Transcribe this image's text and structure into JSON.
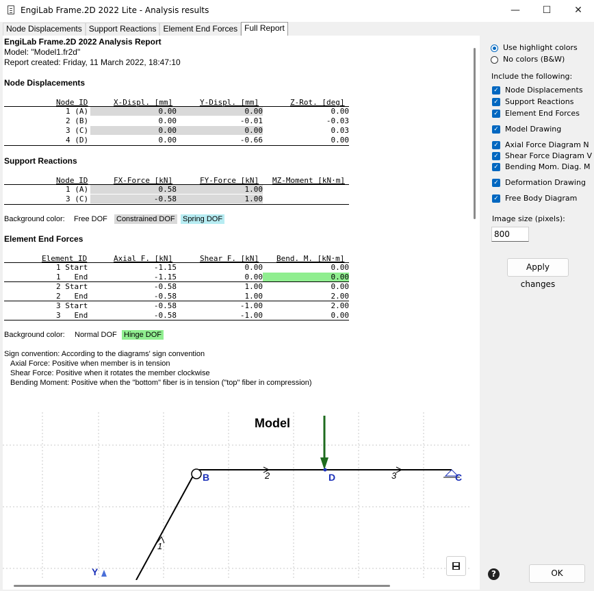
{
  "window": {
    "title": "EngiLab Frame.2D 2022 Lite - Analysis results",
    "minimize": "—",
    "maximize": "☐",
    "close": "✕"
  },
  "tabs": [
    {
      "label": "Node Displacements"
    },
    {
      "label": "Support Reactions"
    },
    {
      "label": "Element End Forces"
    },
    {
      "label": "Full Report",
      "active": true
    }
  ],
  "report": {
    "title": "EngiLab Frame.2D 2022 Analysis Report",
    "model": "Model: \"Model1.fr2d\"",
    "created": "Report created: Friday, 11 March 2022, 18:47:10",
    "node_displacements": {
      "heading": "Node Displacements",
      "columns": [
        "Node ID",
        "X-Displ. [mm]",
        "Y-Displ. [mm]",
        "Z-Rot. [deg]"
      ],
      "rows": [
        [
          "1 (A)",
          "0.00",
          "0.00",
          "0.00"
        ],
        [
          "2 (B)",
          "0.00",
          "-0.01",
          "-0.03"
        ],
        [
          "3 (C)",
          "0.00",
          "0.00",
          "0.03"
        ],
        [
          "4 (D)",
          "0.00",
          "-0.66",
          "0.00"
        ]
      ]
    },
    "support_reactions": {
      "heading": "Support Reactions",
      "columns": [
        "Node ID",
        "FX-Force [kN]",
        "FY-Force [kN]",
        "MZ-Moment [kN·m]"
      ],
      "rows": [
        [
          "1 (A)",
          "0.58",
          "1.00",
          ""
        ],
        [
          "3 (C)",
          "-0.58",
          "1.00",
          ""
        ]
      ]
    },
    "dof_legend": {
      "label": "Background color:",
      "free": "Free DOF",
      "constrained": "Constrained DOF",
      "spring": "Spring DOF"
    },
    "element_end_forces": {
      "heading": "Element End Forces",
      "columns": [
        "Element ID",
        "Axial F. [kN]",
        "Shear F. [kN]",
        "Bend. M. [kN·m]"
      ],
      "rows": [
        [
          "1 Start",
          "-1.15",
          "0.00",
          "0.00"
        ],
        [
          "1   End",
          "-1.15",
          "0.00",
          "0.00"
        ],
        [
          "2 Start",
          "-0.58",
          "1.00",
          "0.00"
        ],
        [
          "2   End",
          "-0.58",
          "1.00",
          "2.00"
        ],
        [
          "3 Start",
          "-0.58",
          "-1.00",
          "2.00"
        ],
        [
          "3   End",
          "-0.58",
          "-1.00",
          "0.00"
        ]
      ]
    },
    "hinge_legend": {
      "label": "Background color:",
      "normal": "Normal DOF",
      "hinge": "Hinge DOF"
    },
    "sign_convention": {
      "line1": "Sign convention: According to the diagrams' sign convention",
      "line2": "Axial Force: Positive when member is in tension",
      "line3": "Shear Force: Positive when it rotates the member clockwise",
      "line4": "Bending Moment: Positive when the \"bottom\" fiber is in tension (\"top\" fiber in compression)"
    },
    "drawing": {
      "title": "Model",
      "node_b": "B",
      "node_c": "C",
      "node_d": "D",
      "elem2": "2",
      "elem3": "3",
      "elem1": "1",
      "axis_y": "Y",
      "colors": {
        "node_label": "#1a2fb8",
        "load_arrow": "#1e6b1e",
        "grid": "#c8c8c8"
      }
    }
  },
  "options": {
    "highlight": "Use highlight colors",
    "no_colors": "No colors (B&W)",
    "include_label": "Include the following:",
    "items": [
      "Node Displacements",
      "Support Reactions",
      "Element End Forces",
      "Model Drawing",
      "Axial Force Diagram N",
      "Shear Force Diagram V",
      "Bending Mom. Diag. M",
      "Deformation Drawing",
      "Free Body Diagram"
    ],
    "image_size_label": "Image size (pixels):",
    "image_size_value": "800",
    "apply": "Apply changes",
    "ok": "OK",
    "help": "?"
  },
  "colors": {
    "constrained": "#d9d9d9",
    "spring": "#b7ecf2",
    "hinge": "#90ee90",
    "accent": "#0067c0"
  }
}
